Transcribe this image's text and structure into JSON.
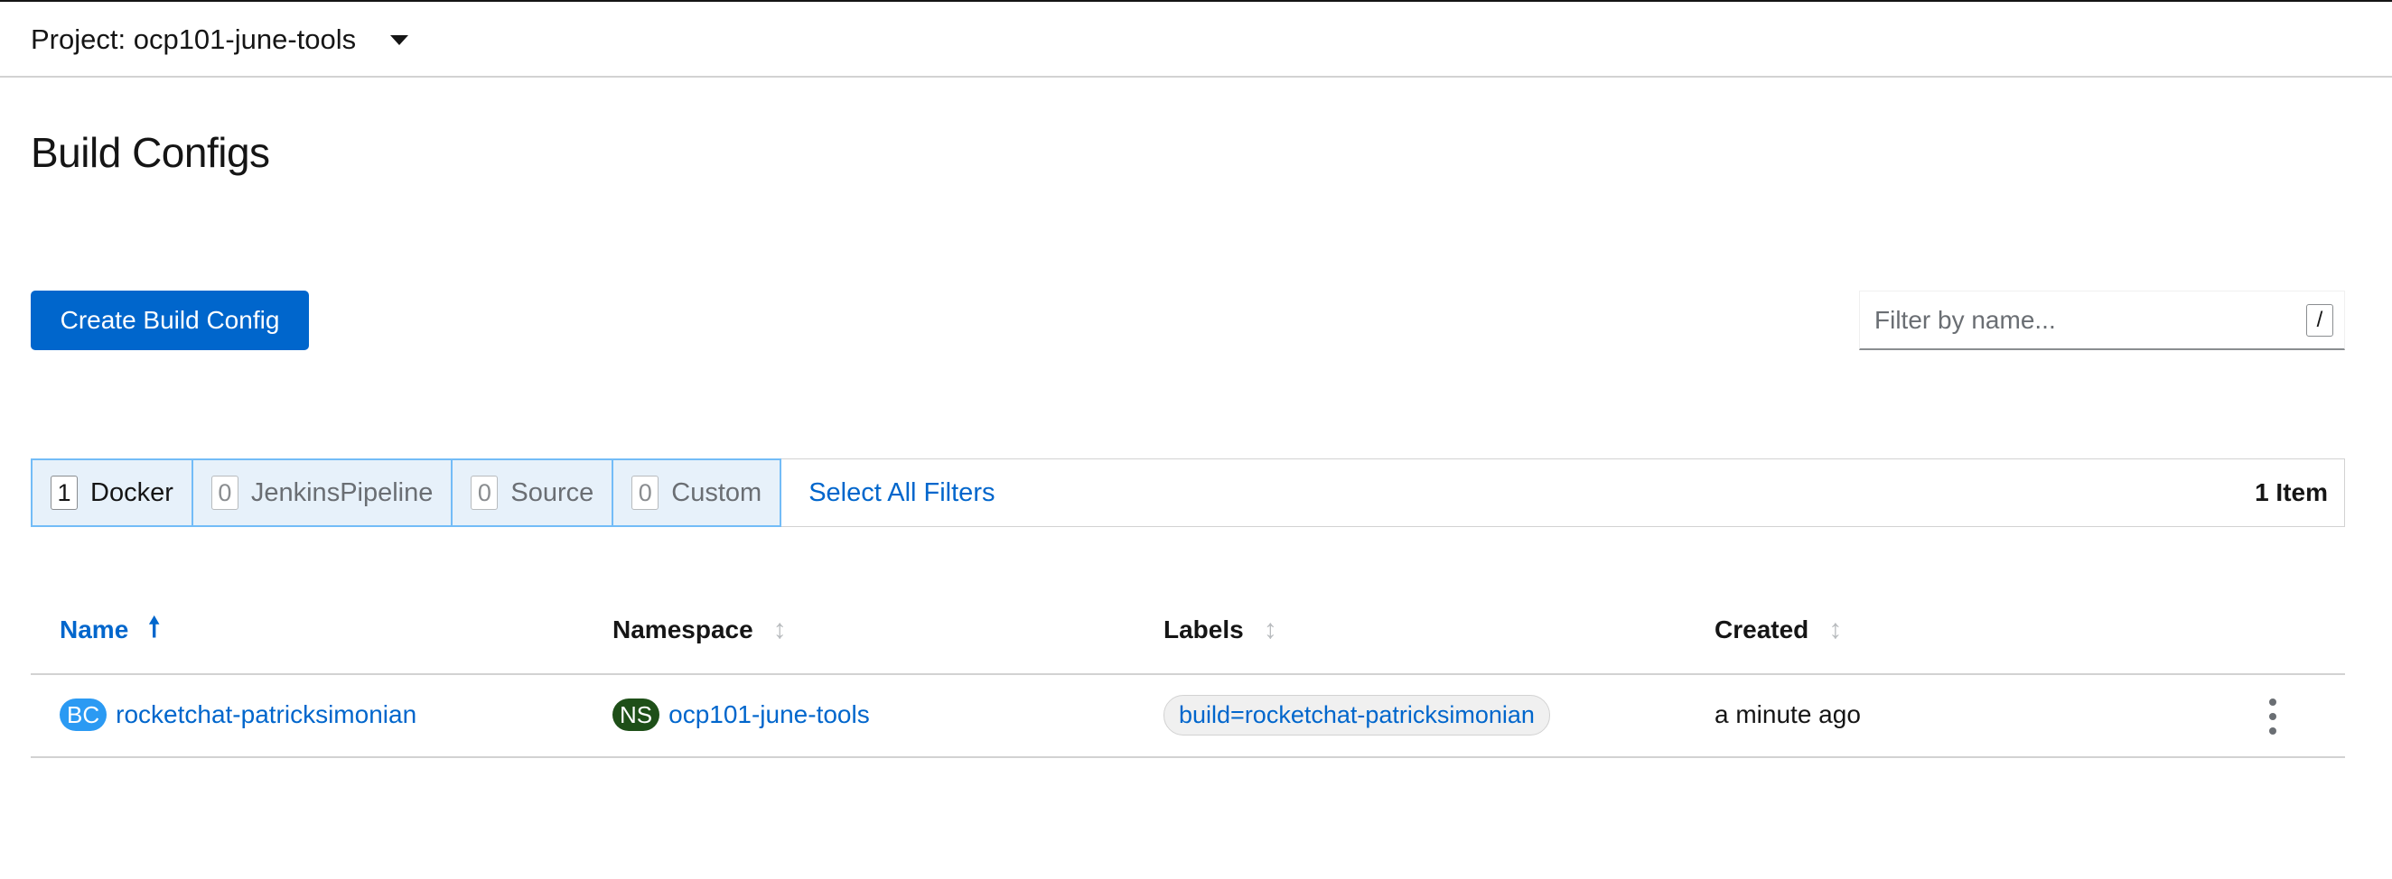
{
  "project": {
    "label": "Project: ocp101-june-tools"
  },
  "page": {
    "title": "Build Configs"
  },
  "toolbar": {
    "create_label": "Create Build Config",
    "filter_placeholder": "Filter by name...",
    "filter_shortcut": "/"
  },
  "type_filters": [
    {
      "count": "1",
      "label": "Docker",
      "active": true
    },
    {
      "count": "0",
      "label": "JenkinsPipeline",
      "active": false
    },
    {
      "count": "0",
      "label": "Source",
      "active": false
    },
    {
      "count": "0",
      "label": "Custom",
      "active": false
    }
  ],
  "select_all_label": "Select All Filters",
  "item_count": "1 Item",
  "table": {
    "columns": [
      "Name",
      "Namespace",
      "Labels",
      "Created"
    ],
    "sorted_column": "Name",
    "rows": [
      {
        "name_badge": "BC",
        "name": "rocketchat-patricksimonian",
        "namespace_badge": "NS",
        "namespace": "ocp101-june-tools",
        "label": "build=rocketchat-patricksimonian",
        "created": "a minute ago"
      }
    ]
  },
  "colors": {
    "primary": "#0066cc",
    "bc_badge": "#2b9af3",
    "ns_badge": "#1e4f18",
    "filter_bg": "#e7f1fa",
    "filter_border": "#73bcf7"
  },
  "icons": {
    "project_dropdown": "caret-down-icon",
    "sort_asc": "long-arrow-up-icon",
    "sort_none": "sort-icon",
    "row_actions": "kebab-icon"
  }
}
